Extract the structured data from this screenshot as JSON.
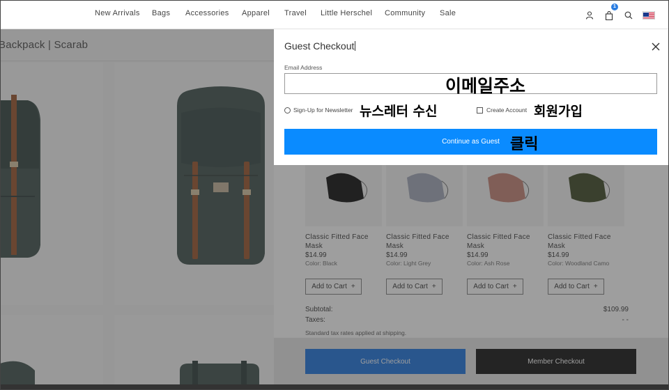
{
  "nav": {
    "links": [
      "New Arrivals",
      "Bags",
      "Accessories",
      "Apparel",
      "Travel",
      "Little Herschel",
      "Community",
      "Sale"
    ],
    "cart_count": "1",
    "icons": [
      "user-icon",
      "bag-icon",
      "search-icon",
      "us-flag-icon"
    ]
  },
  "background": {
    "title": "Backpack | Scarab"
  },
  "modal": {
    "title": "Guest Checkout",
    "email_label": "Email Address",
    "email_value": "",
    "newsletter_label": "Sign-Up for Newsletter",
    "create_account_label": "Create Account",
    "continue_label": "Continue as Guest"
  },
  "annotations": {
    "email": "이메일주소",
    "newsletter": "뉴스레터 수신",
    "create_account": "회원가입",
    "click": "클릭"
  },
  "cart": {
    "products": [
      {
        "name": "Classic Fitted Face Mask",
        "price": "$14.99",
        "color": "Color: Black",
        "add_label": "Add to Cart",
        "swatch": "#1c1c1c"
      },
      {
        "name": "Classic Fitted Face Mask",
        "price": "$14.99",
        "color": "Color: Light Grey",
        "add_label": "Add to Cart",
        "swatch": "#a8aebd"
      },
      {
        "name": "Classic Fitted Face Mask",
        "price": "$14.99",
        "color": "Color: Ash Rose",
        "add_label": "Add to Cart",
        "swatch": "#c98a7e"
      },
      {
        "name": "Classic Fitted Face Mask",
        "price": "$14.99",
        "color": "Color: Woodland Camo",
        "add_label": "Add to Cart",
        "swatch": "#4a5534"
      }
    ],
    "subtotal_label": "Subtotal:",
    "subtotal_value": "$109.99",
    "taxes_label": "Taxes:",
    "taxes_value": "- -",
    "tax_note": "Standard tax rates applied at shipping.",
    "guest_checkout_label": "Guest Checkout",
    "member_checkout_label": "Member Checkout"
  },
  "colors": {
    "accent": "#0a8bff",
    "guest_button": "#2a7de1",
    "member_button": "#222222",
    "backpack": "#4b5c58",
    "strap": "#a0603a"
  }
}
